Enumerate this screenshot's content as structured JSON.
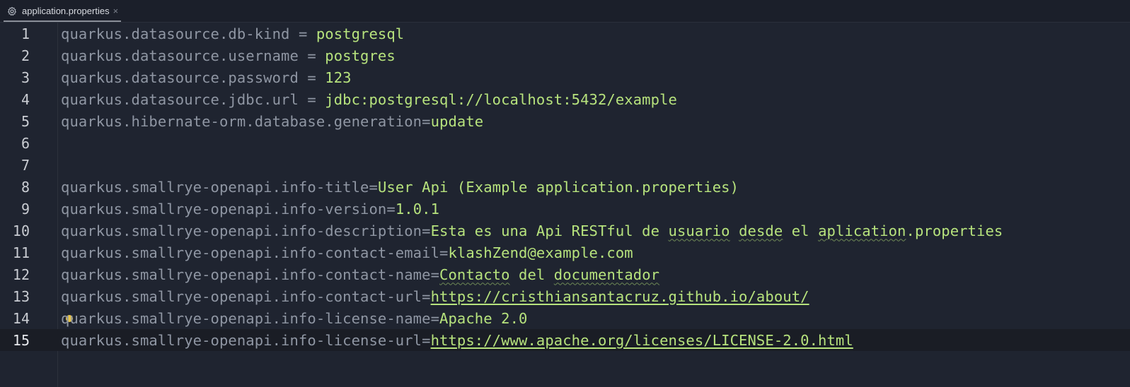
{
  "tab": {
    "title": "application.properties",
    "close": "×",
    "icon": "gear-icon"
  },
  "colors": {
    "background": "#1f2430",
    "key": "#8f96a3",
    "value": "#b7e37d",
    "line_number": "#c9ccd2"
  },
  "lines": [
    {
      "n": "1",
      "key": "quarkus.datasource.db-kind",
      "sep": " = ",
      "val": "postgresql"
    },
    {
      "n": "2",
      "key": "quarkus.datasource.username",
      "sep": " = ",
      "val": "postgres"
    },
    {
      "n": "3",
      "key": "quarkus.datasource.password",
      "sep": " = ",
      "val": "123"
    },
    {
      "n": "4",
      "key": "quarkus.datasource.jdbc.url",
      "sep": " = ",
      "val": "jdbc:postgresql://localhost:5432/example"
    },
    {
      "n": "5",
      "key": "quarkus.hibernate-orm.database.generation",
      "sep": "=",
      "val": "update"
    },
    {
      "n": "6",
      "key": "",
      "sep": "",
      "val": ""
    },
    {
      "n": "7",
      "key": "",
      "sep": "",
      "val": ""
    },
    {
      "n": "8",
      "key": "quarkus.smallrye-openapi.info-title",
      "sep": "=",
      "val": "User Api (Example application.properties)"
    },
    {
      "n": "9",
      "key": "quarkus.smallrye-openapi.info-version",
      "sep": "=",
      "val": "1.0.1"
    },
    {
      "n": "10",
      "key": "quarkus.smallrye-openapi.info-description",
      "sep": "=",
      "v1": "Esta es una Api RESTful de ",
      "w1": "usuario",
      "v2": " ",
      "w2": "desde",
      "v3": " el ",
      "w3": "aplication",
      "v4": ".properties"
    },
    {
      "n": "11",
      "key": "quarkus.smallrye-openapi.info-contact-email",
      "sep": "=",
      "val": "klashZend@example.com"
    },
    {
      "n": "12",
      "key": "quarkus.smallrye-openapi.info-contact-name",
      "sep": "=",
      "w1": "Contacto",
      "v1": " del ",
      "w2": "documentador"
    },
    {
      "n": "13",
      "key": "quarkus.smallrye-openapi.info-contact-url",
      "sep": "=",
      "val": "https://cristhiansantacruz.github.io/about/"
    },
    {
      "n": "14",
      "key": "quarkus.smallrye-openapi.info-license-name",
      "sep": "=",
      "val": "Apache 2.0"
    },
    {
      "n": "15",
      "key": "quarkus.smallrye-openapi.info-license-url",
      "sep": "=",
      "val": "https://www.apache.org/licenses/LICENSE-2.0.html"
    }
  ]
}
